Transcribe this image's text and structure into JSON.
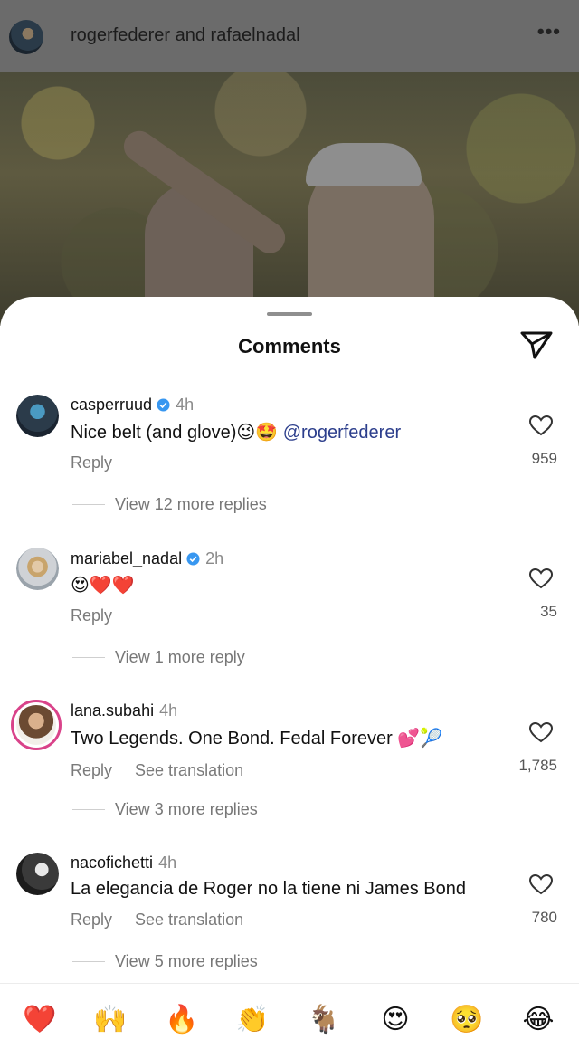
{
  "post": {
    "title": "rogerfederer and rafaelnadal",
    "more_icon": "more-horizontal-icon",
    "more_glyph": "•••"
  },
  "sheet": {
    "title": "Comments",
    "send_icon": "send-icon"
  },
  "comments": [
    {
      "user": "casperruud",
      "verified": true,
      "time": "4h",
      "text": "Nice belt (and glove)😉🤩",
      "mention": "@rogerfederer",
      "reply": "Reply",
      "see_translation": "",
      "likes": "959",
      "view_more": "View 12 more replies",
      "ring": false
    },
    {
      "user": "mariabel_nadal",
      "verified": true,
      "time": "2h",
      "text": "😍❤️❤️",
      "mention": "",
      "reply": "Reply",
      "see_translation": "",
      "likes": "35",
      "view_more": "View 1 more reply",
      "ring": false
    },
    {
      "user": "lana.subahi",
      "verified": false,
      "time": "4h",
      "text": "Two Legends. One Bond. Fedal Forever 💕🎾",
      "mention": "",
      "reply": "Reply",
      "see_translation": "See translation",
      "likes": "1,785",
      "view_more": "View 3 more replies",
      "ring": true
    },
    {
      "user": "nacofichetti",
      "verified": false,
      "time": "4h",
      "text": "La elegancia de Roger no la tiene ni James Bond",
      "mention": "",
      "reply": "Reply",
      "see_translation": "See translation",
      "likes": "780",
      "view_more": "View 5 more replies",
      "ring": false
    }
  ],
  "emoji_bar": [
    "❤️",
    "🙌",
    "🔥",
    "👏",
    "🐐",
    "😍",
    "🥺",
    "😂"
  ],
  "colors": {
    "accent_blue": "#2c3e8c",
    "verified_blue": "#3897f0",
    "story_ring": "#d9438a"
  }
}
